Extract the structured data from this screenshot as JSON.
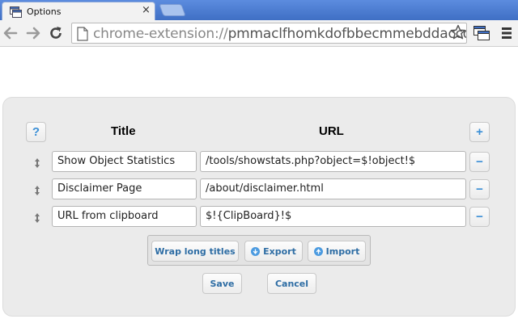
{
  "browser": {
    "tab_title": "Options",
    "tab_close": "×",
    "url_scheme": "chrome-extension://",
    "url_host": "pmmaclfhomkdofbbecmmebddaccdpjgg/"
  },
  "options": {
    "help_button": "?",
    "add_button": "+",
    "headers": {
      "title": "Title",
      "url": "URL"
    },
    "rows": [
      {
        "title": "Show Object Statistics",
        "url": "/tools/showstats.php?object=$!object!$",
        "remove": "−"
      },
      {
        "title": "Disclaimer Page",
        "url": "/about/disclaimer.html",
        "remove": "−"
      },
      {
        "title": "URL from clipboard",
        "url": "$!{ClipBoard}!$",
        "remove": "−"
      }
    ],
    "tools": {
      "wrap_label": "Wrap long titles",
      "export_label": "Export",
      "import_label": "Import"
    },
    "save_label": "Save",
    "cancel_label": "Cancel"
  },
  "colors": {
    "accent": "#3b8fd6",
    "tabstrip": "#4a7bd0",
    "panel": "#ebebeb"
  }
}
